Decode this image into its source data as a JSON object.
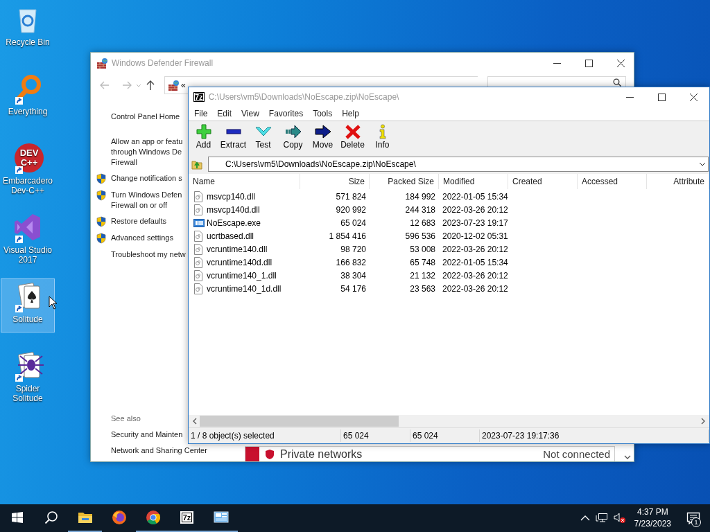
{
  "desktop": {
    "icons": [
      {
        "label": "Recycle Bin",
        "kind": "recycle",
        "shortcut": false,
        "selected": false
      },
      {
        "label": "Everything",
        "kind": "magnifier",
        "shortcut": true,
        "selected": false
      },
      {
        "label": "Embarcadero Dev-C++",
        "kind": "logo",
        "logo_lines": [
          "DEV",
          "C++"
        ],
        "shortcut": true,
        "selected": false
      },
      {
        "label": "Visual Studio 2017",
        "kind": "ribbon",
        "shortcut": true,
        "selected": false
      },
      {
        "label": "Solitude",
        "kind": "cards",
        "shortcut": true,
        "selected": true
      },
      {
        "label": "Spider Solitude",
        "kind": "spider",
        "shortcut": true,
        "selected": false
      }
    ]
  },
  "firewall_window": {
    "title": "Windows Defender Firewall",
    "address_prefix": "«",
    "sidebar": {
      "home": "Control Panel Home",
      "links": [
        {
          "lines": [
            "Allow an app or featu",
            "through Windows De",
            "Firewall"
          ],
          "shield": false
        },
        {
          "lines": [
            "Change notification s"
          ],
          "shield": true
        },
        {
          "lines": [
            "Turn Windows Defen",
            "Firewall on or off"
          ],
          "shield": true
        },
        {
          "lines": [
            "Restore defaults"
          ],
          "shield": true
        },
        {
          "lines": [
            "Advanced settings"
          ],
          "shield": true
        },
        {
          "lines": [
            "Troubleshoot my netw"
          ],
          "shield": false
        }
      ],
      "see_also_title": "See also",
      "see_also": [
        "Security and Mainten",
        "Network and Sharing Center"
      ]
    },
    "network_row": {
      "label": "Private networks",
      "status": "Not connected"
    }
  },
  "archive_window": {
    "title_badge": "7z",
    "title": "C:\\Users\\vm5\\Downloads\\NoEscape.zip\\NoEscape\\",
    "menu": [
      "File",
      "Edit",
      "View",
      "Favorites",
      "Tools",
      "Help"
    ],
    "toolbar": [
      {
        "label": "Add",
        "kind": "add"
      },
      {
        "label": "Extract",
        "kind": "extract"
      },
      {
        "label": "Test",
        "kind": "test"
      },
      {
        "label": "Copy",
        "kind": "copy"
      },
      {
        "label": "Move",
        "kind": "move"
      },
      {
        "label": "Delete",
        "kind": "delete"
      },
      {
        "label": "Info",
        "kind": "info"
      }
    ],
    "path": "C:\\Users\\vm5\\Downloads\\NoEscape.zip\\NoEscape\\",
    "columns": [
      {
        "label": "Name"
      },
      {
        "label": "Size"
      },
      {
        "label": "Packed Size"
      },
      {
        "label": "Modified"
      },
      {
        "label": "Created"
      },
      {
        "label": "Accessed"
      },
      {
        "label": "Attribute"
      }
    ],
    "rows": [
      {
        "kind": "dll",
        "cells": [
          "msvcp140.dll",
          "571 824",
          "184 992",
          "2022-01-05 15:34"
        ]
      },
      {
        "kind": "dll",
        "cells": [
          "msvcp140d.dll",
          "920 992",
          "244 318",
          "2022-03-26 20:12"
        ]
      },
      {
        "kind": "exe",
        "cells": [
          "NoEscape.exe",
          "65 024",
          "12 683",
          "2023-07-23 19:17"
        ]
      },
      {
        "kind": "dll",
        "cells": [
          "ucrtbased.dll",
          "1 854 416",
          "596 536",
          "2020-12-02 05:31"
        ]
      },
      {
        "kind": "dll",
        "cells": [
          "vcruntime140.dll",
          "98 720",
          "53 008",
          "2022-03-26 20:12"
        ]
      },
      {
        "kind": "dll",
        "cells": [
          "vcruntime140d.dll",
          "166 832",
          "65 748",
          "2022-01-05 15:34"
        ]
      },
      {
        "kind": "dll",
        "cells": [
          "vcruntime140_1.dll",
          "38 304",
          "21 132",
          "2022-03-26 20:12"
        ]
      },
      {
        "kind": "dll",
        "cells": [
          "vcruntime140_1d.dll",
          "54 176",
          "23 563",
          "2022-03-26 20:12"
        ]
      }
    ],
    "status": [
      "1 / 8 object(s) selected",
      "65 024",
      "65 024",
      "2023-07-23 19:17:36"
    ]
  },
  "taskbar": {
    "apps": [
      {
        "kind": "explorer",
        "running": true
      },
      {
        "kind": "firefox",
        "running": false
      },
      {
        "kind": "chrome",
        "running": true
      },
      {
        "kind": "archiver",
        "label": "7z",
        "running": true
      },
      {
        "kind": "control-panel",
        "running": true
      }
    ],
    "clock": {
      "time": "4:37 PM",
      "date": "7/23/2023"
    },
    "notifications": "1"
  }
}
